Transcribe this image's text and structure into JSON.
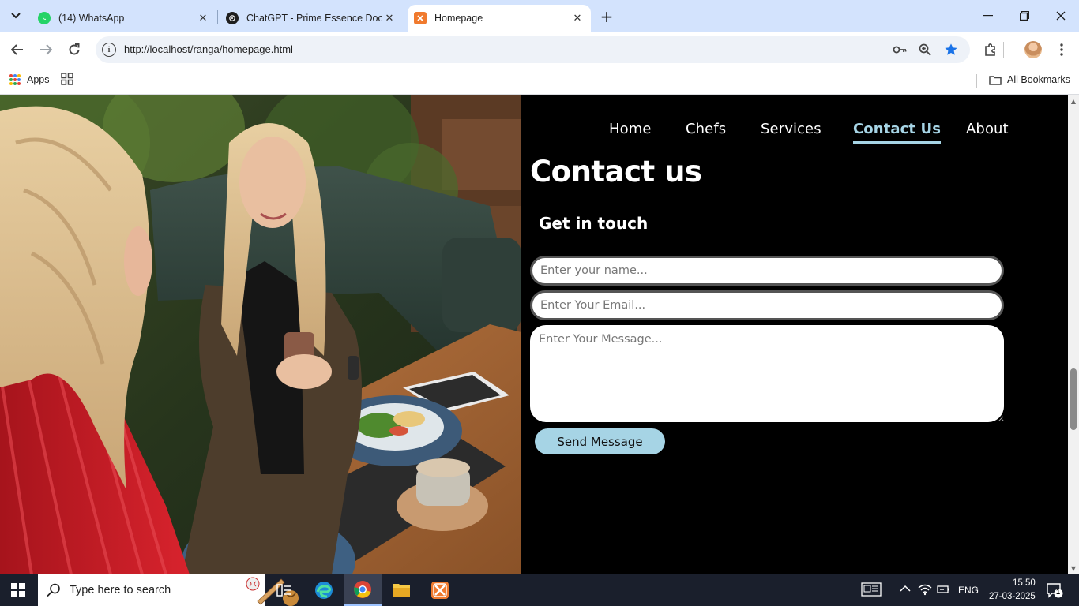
{
  "browser": {
    "tabs": [
      {
        "title": "(14) WhatsApp",
        "active": false,
        "favicon": "whatsapp-icon"
      },
      {
        "title": "ChatGPT - Prime Essence Doc",
        "active": false,
        "favicon": "chatgpt-icon"
      },
      {
        "title": "Homepage",
        "active": true,
        "favicon": "xampp-icon"
      }
    ],
    "url": "http://localhost/ranga/homepage.html",
    "bookmarks": {
      "apps_label": "Apps",
      "all_bookmarks_label": "All Bookmarks"
    }
  },
  "site": {
    "nav": [
      {
        "label": "Home",
        "active": false
      },
      {
        "label": "Chefs",
        "active": false
      },
      {
        "label": "Services",
        "active": false
      },
      {
        "label": "Contact Us",
        "active": true
      },
      {
        "label": "About",
        "active": false
      }
    ],
    "contact": {
      "heading": "Contact us",
      "subheading": "Get in touch",
      "name_placeholder": "Enter your name...",
      "email_placeholder": "Enter Your Email...",
      "message_placeholder": "Enter Your Message...",
      "submit_label": "Send Message"
    },
    "accent_color": "#a6d4e5"
  },
  "taskbar": {
    "search_placeholder": "Type here to search",
    "language": "ENG",
    "time": "15:50",
    "date": "27-03-2025",
    "notification_count": "1"
  }
}
